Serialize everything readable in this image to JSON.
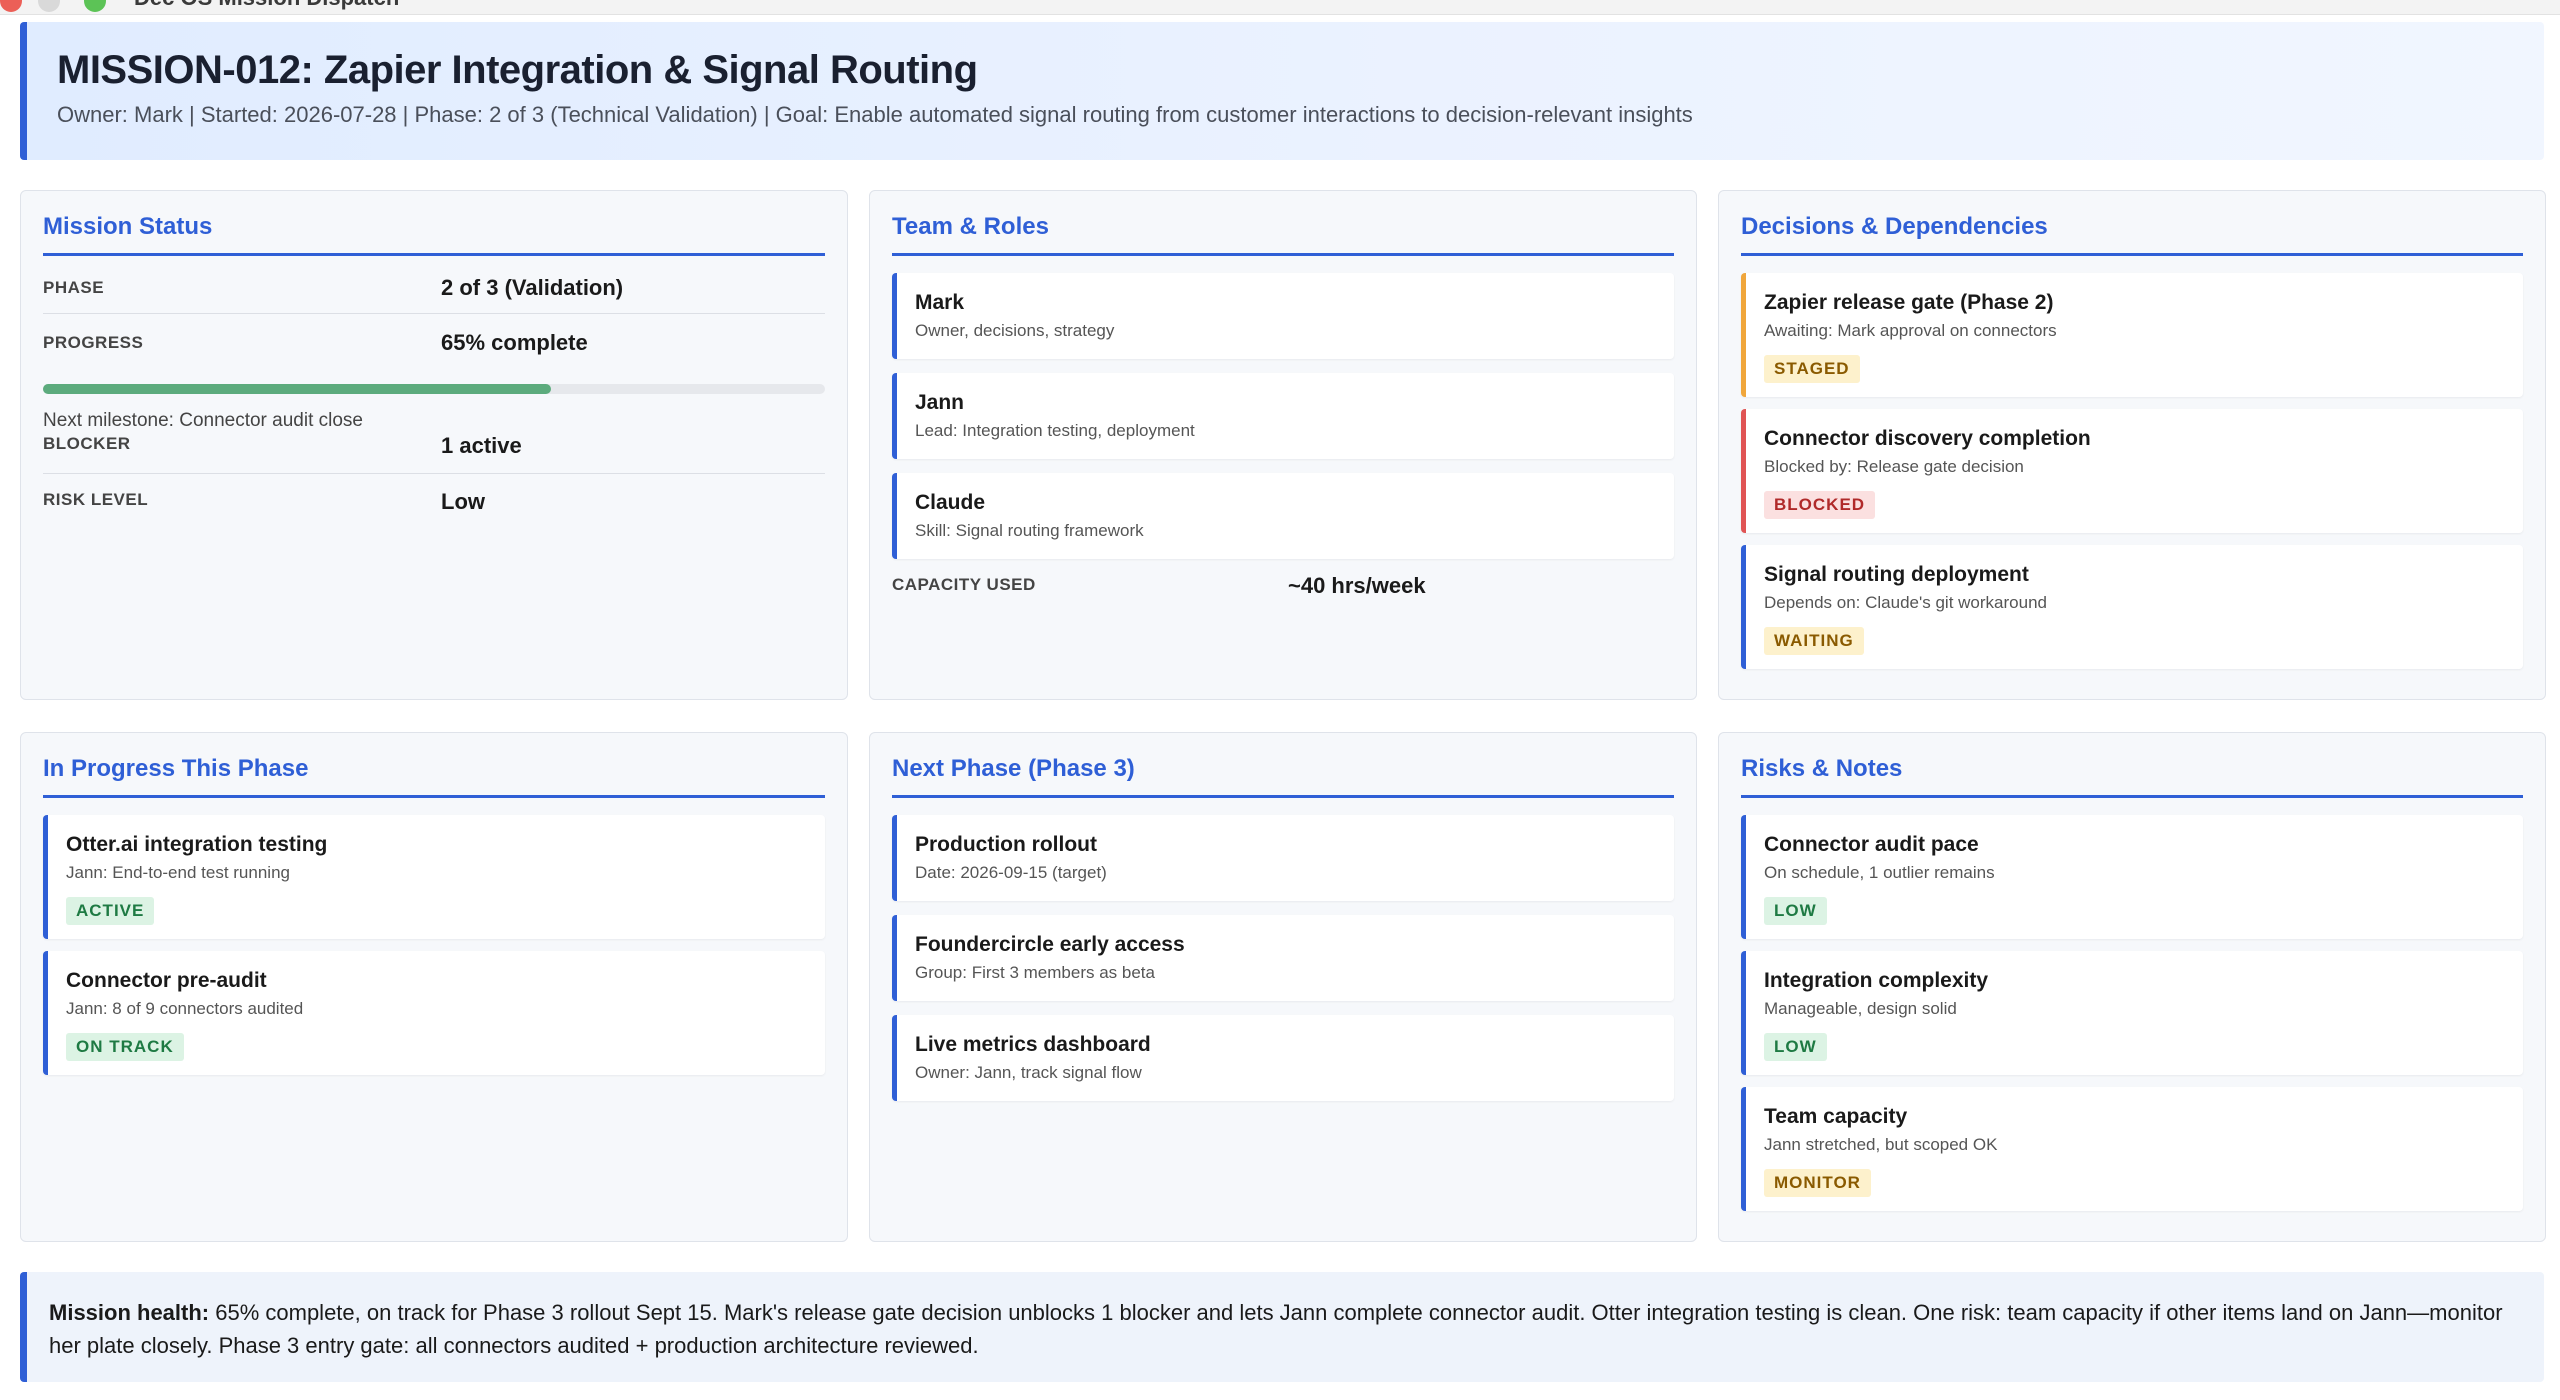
{
  "window": {
    "title": "Dec OS Mission Dispatch"
  },
  "header": {
    "title": "MISSION-012: Zapier Integration & Signal Routing",
    "meta": "Owner: Mark | Started: 2026-07-28 | Phase: 2 of 3 (Technical Validation) | Goal: Enable automated signal routing from customer interactions to decision-relevant insights"
  },
  "status": {
    "title": "Mission Status",
    "phase_label": "PHASE",
    "phase_value": "2 of 3 (Validation)",
    "progress_label": "PROGRESS",
    "progress_value": "65% complete",
    "progress_fraction": 0.65,
    "milestone": "Next milestone: Connector audit close",
    "blocker_label": "BLOCKER",
    "blocker_value": "1 active",
    "risk_label": "RISK LEVEL",
    "risk_value": "Low"
  },
  "team": {
    "title": "Team & Roles",
    "members": [
      {
        "name": "Mark",
        "role": "Owner, decisions, strategy"
      },
      {
        "name": "Jann",
        "role": "Lead: Integration testing, deployment"
      },
      {
        "name": "Claude",
        "role": "Skill: Signal routing framework"
      }
    ],
    "capacity_label": "CAPACITY USED",
    "capacity_value": "~40 hrs/week"
  },
  "decisions": {
    "title": "Decisions & Dependencies",
    "items": [
      {
        "title": "Zapier release gate (Phase 2)",
        "sub": "Awaiting: Mark approval on connectors",
        "badge": "STAGED"
      },
      {
        "title": "Connector discovery completion",
        "sub": "Blocked by: Release gate decision",
        "badge": "BLOCKED"
      },
      {
        "title": "Signal routing deployment",
        "sub": "Depends on: Claude's git workaround",
        "badge": "WAITING"
      }
    ]
  },
  "in_progress": {
    "title": "In Progress This Phase",
    "items": [
      {
        "title": "Otter.ai integration testing",
        "sub": "Jann: End-to-end test running",
        "badge": "ACTIVE"
      },
      {
        "title": "Connector pre-audit",
        "sub": "Jann: 8 of 9 connectors audited",
        "badge": "ON TRACK"
      }
    ]
  },
  "next_phase": {
    "title": "Next Phase (Phase 3)",
    "items": [
      {
        "title": "Production rollout",
        "sub": "Date: 2026-09-15 (target)"
      },
      {
        "title": "Foundercircle early access",
        "sub": "Group: First 3 members as beta"
      },
      {
        "title": "Live metrics dashboard",
        "sub": "Owner: Jann, track signal flow"
      }
    ]
  },
  "risks": {
    "title": "Risks & Notes",
    "items": [
      {
        "title": "Connector audit pace",
        "sub": "On schedule, 1 outlier remains",
        "badge": "LOW"
      },
      {
        "title": "Integration complexity",
        "sub": "Manageable, design solid",
        "badge": "LOW"
      },
      {
        "title": "Team capacity",
        "sub": "Jann stretched, but scoped OK",
        "badge": "MONITOR"
      }
    ]
  },
  "summary": {
    "label": "Mission health:",
    "text": " 65% complete, on track for Phase 3 rollout Sept 15. Mark's release gate decision unblocks 1 blocker and lets Jann complete connector audit. Otter integration testing is clean. One risk: team capacity if other items land on Jann—monitor her plate closely. Phase 3 entry gate: all connectors audited + production architecture reviewed."
  },
  "colors": {
    "accent": "#2f5fd6",
    "progress": "#5cab7d",
    "staged": "#f0a63b",
    "blocked": "#e05454"
  }
}
